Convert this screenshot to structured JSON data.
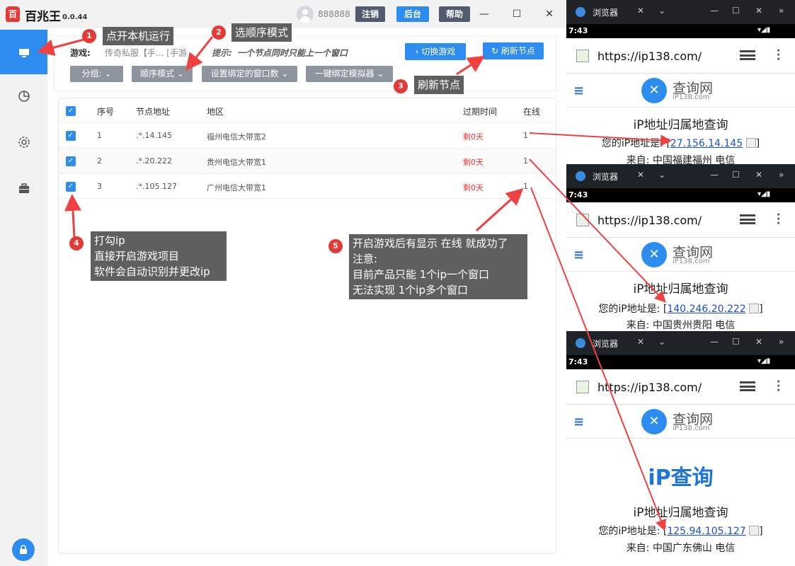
{
  "app": {
    "name": "百兆王",
    "version": "0.0.44",
    "user": "888888",
    "logout": "注销",
    "admin": "后台",
    "help": "帮助",
    "minimize": "—",
    "maximize": "☐",
    "close": "✕"
  },
  "toolbar": {
    "game_label": "游戏:",
    "game_value": "传奇私服【手... [手游",
    "tip_label": "提示:",
    "tip_text": "一个节点同时只能上一个窗口",
    "switch_game": "› 切换游戏",
    "refresh_node": "↻ 刷新节点",
    "group": "分组: ⌄",
    "order_mode": "顺序模式 ⌄",
    "bind_count": "设置绑定的窗口数 ⌄",
    "bind_emulator": "一键绑定模拟器 ⌄"
  },
  "table": {
    "headers": {
      "index": "序号",
      "node": "节点地址",
      "region": "地区",
      "expire": "过期时间",
      "online": "在线"
    },
    "rows": [
      {
        "index": "1",
        "node": ".*.14.145",
        "region": "福州电信大带宽2",
        "expire": "剩0天",
        "online": "1"
      },
      {
        "index": "2",
        "node": ".*.20.222",
        "region": "贵州电信大带宽1",
        "expire": "剩0天",
        "online": "1"
      },
      {
        "index": "3",
        "node": ".*.105.127",
        "region": "广州电信大带宽1",
        "expire": "剩0天",
        "online": "1"
      }
    ]
  },
  "callouts": {
    "c1_num": "1",
    "c1": "点开本机运行",
    "c2_num": "2",
    "c2": "选顺序模式",
    "c3_num": "3",
    "c3": "刷新节点",
    "c4_num": "4",
    "c4_l1": "打勾ip",
    "c4_l2": "直接开启游戏项目",
    "c4_l3": "软件会自动识别并更改ip",
    "c5_num": "5",
    "c5_l1": "开启游戏后有显示 在线 就成功了",
    "c5_l2": "注意:",
    "c5_l3": "目前产品只能 1个ip一个窗口",
    "c5_l4": "无法实现 1个ip多个窗口"
  },
  "phones": [
    {
      "tab_title": "浏览器",
      "time": "7:43",
      "url": "https://ip138.com/",
      "site_name": "查询网",
      "site_sub": "iP138.com",
      "heading": "iP地址归属地查询",
      "ip_prefix": "您的iP地址是: [",
      "ip": "27.156.14.145",
      "ip_suffix": "]",
      "from": "来自: 中国福建福州 电信"
    },
    {
      "tab_title": "浏览器",
      "time": "7:43",
      "url": "https://ip138.com/",
      "site_name": "查询网",
      "site_sub": "iP138.com",
      "heading": "iP地址归属地查询",
      "ip_prefix": "您的iP地址是: [",
      "ip": "140.246.20.222",
      "ip_suffix": "]",
      "from": "来自: 中国贵州贵阳 电信"
    },
    {
      "tab_title": "浏览器",
      "time": "7:43",
      "url": "https://ip138.com/",
      "site_name": "查询网",
      "site_sub": "iP138.com",
      "big_title": "iP查询",
      "heading": "iP地址归属地查询",
      "ip_prefix": "您的iP地址是: [",
      "ip": "125.94.105.127",
      "ip_suffix": "]",
      "from": "来自: 中国广东佛山 电信"
    }
  ],
  "icons": {
    "logo": "app-logo-icon",
    "monitor": "monitor-icon",
    "chart": "pie-chart-icon",
    "gear": "gear-icon",
    "toolbox": "toolbox-icon",
    "lock": "lock-icon"
  },
  "colors": {
    "accent": "#2d8cf0",
    "danger": "#e53935",
    "callout": "#5f5f5f"
  }
}
